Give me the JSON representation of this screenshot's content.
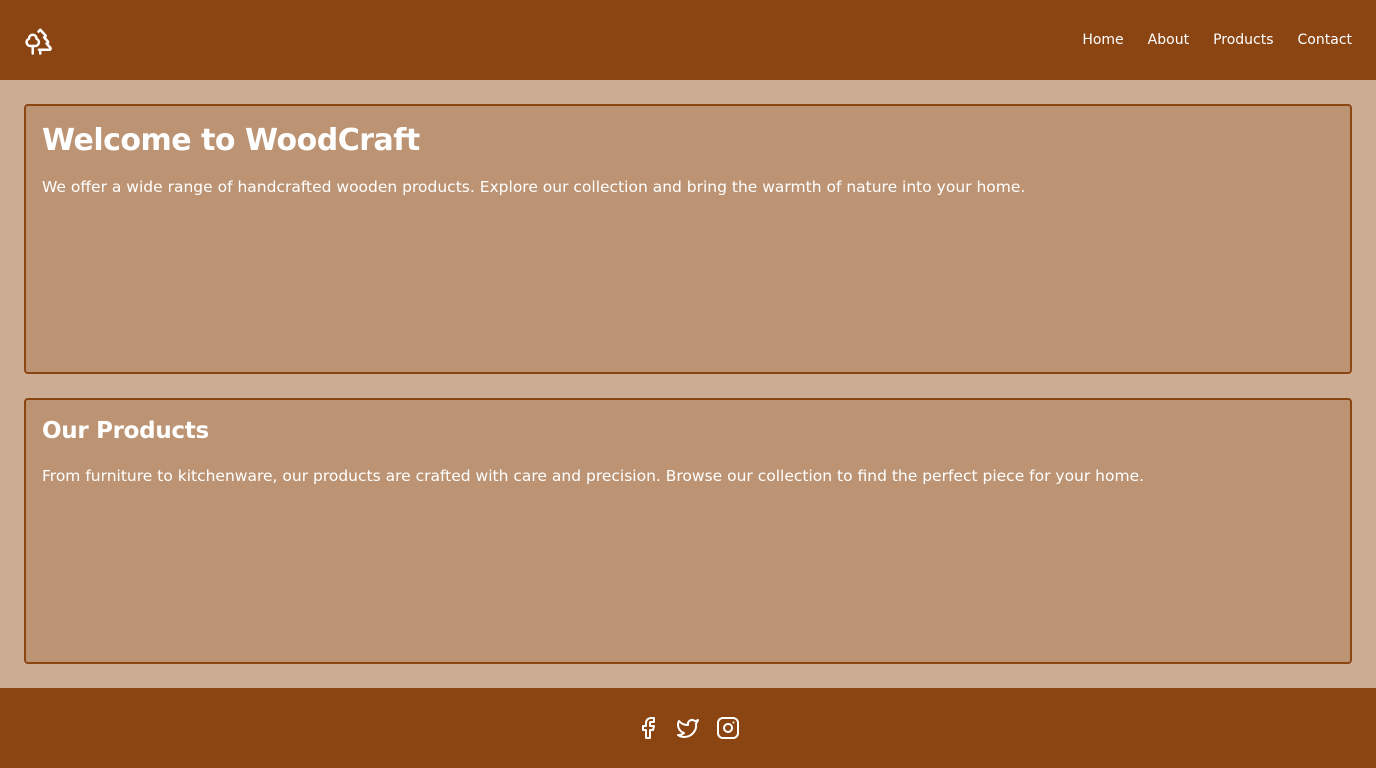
{
  "header": {
    "logo_icon": "trees-icon",
    "nav": [
      {
        "label": "Home"
      },
      {
        "label": "About"
      },
      {
        "label": "Products"
      },
      {
        "label": "Contact"
      }
    ]
  },
  "welcome": {
    "title": "Welcome to WoodCraft",
    "text": "We offer a wide range of handcrafted wooden products. Explore our collection and bring the warmth of nature into your home."
  },
  "products": {
    "title": "Our Products",
    "text": "From furniture to kitchenware, our products are crafted with care and precision. Browse our collection to find the perfect piece for your home."
  },
  "footer": {
    "social_icons": [
      "facebook-icon",
      "twitter-icon",
      "instagram-icon"
    ]
  },
  "colors": {
    "header_bg": "#8b4513",
    "page_bg": "#ccac93",
    "card_bg": "#bc9474",
    "card_border": "#8b4513",
    "text": "#ffffff"
  }
}
